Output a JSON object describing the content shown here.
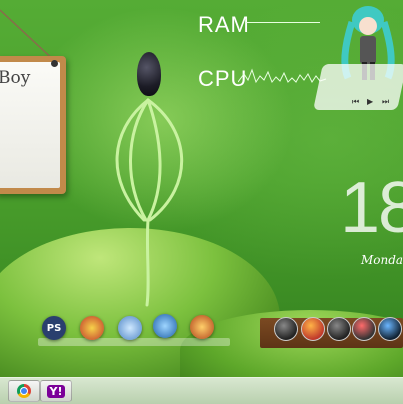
{
  "note": {
    "text": "Boy"
  },
  "meters": {
    "ram_label": "RAM",
    "cpu_label": "CPU"
  },
  "clock": {
    "time": "18",
    "day": "Monda"
  },
  "dock": {
    "left_icons": [
      "ps-icon",
      "pokeball-icon",
      "leaf-icon",
      "monitor-icon",
      "mandala-icon"
    ],
    "ps_label": "PS",
    "right_icons": [
      "display-icon",
      "firefox-icon",
      "fan-icon",
      "media-icon",
      "bluray-icon"
    ]
  },
  "player": {
    "prev": "⏮",
    "play": "▶",
    "next": "⏭"
  },
  "taskbar": {
    "items": [
      "chrome-icon",
      "yahoo-messenger-icon"
    ],
    "yahoo_glyph": "Y!"
  },
  "colors": {
    "wallpaper": "#4aa32e",
    "taskbar": "#c8dcbf",
    "dock_wood": "#6b3e1b"
  }
}
